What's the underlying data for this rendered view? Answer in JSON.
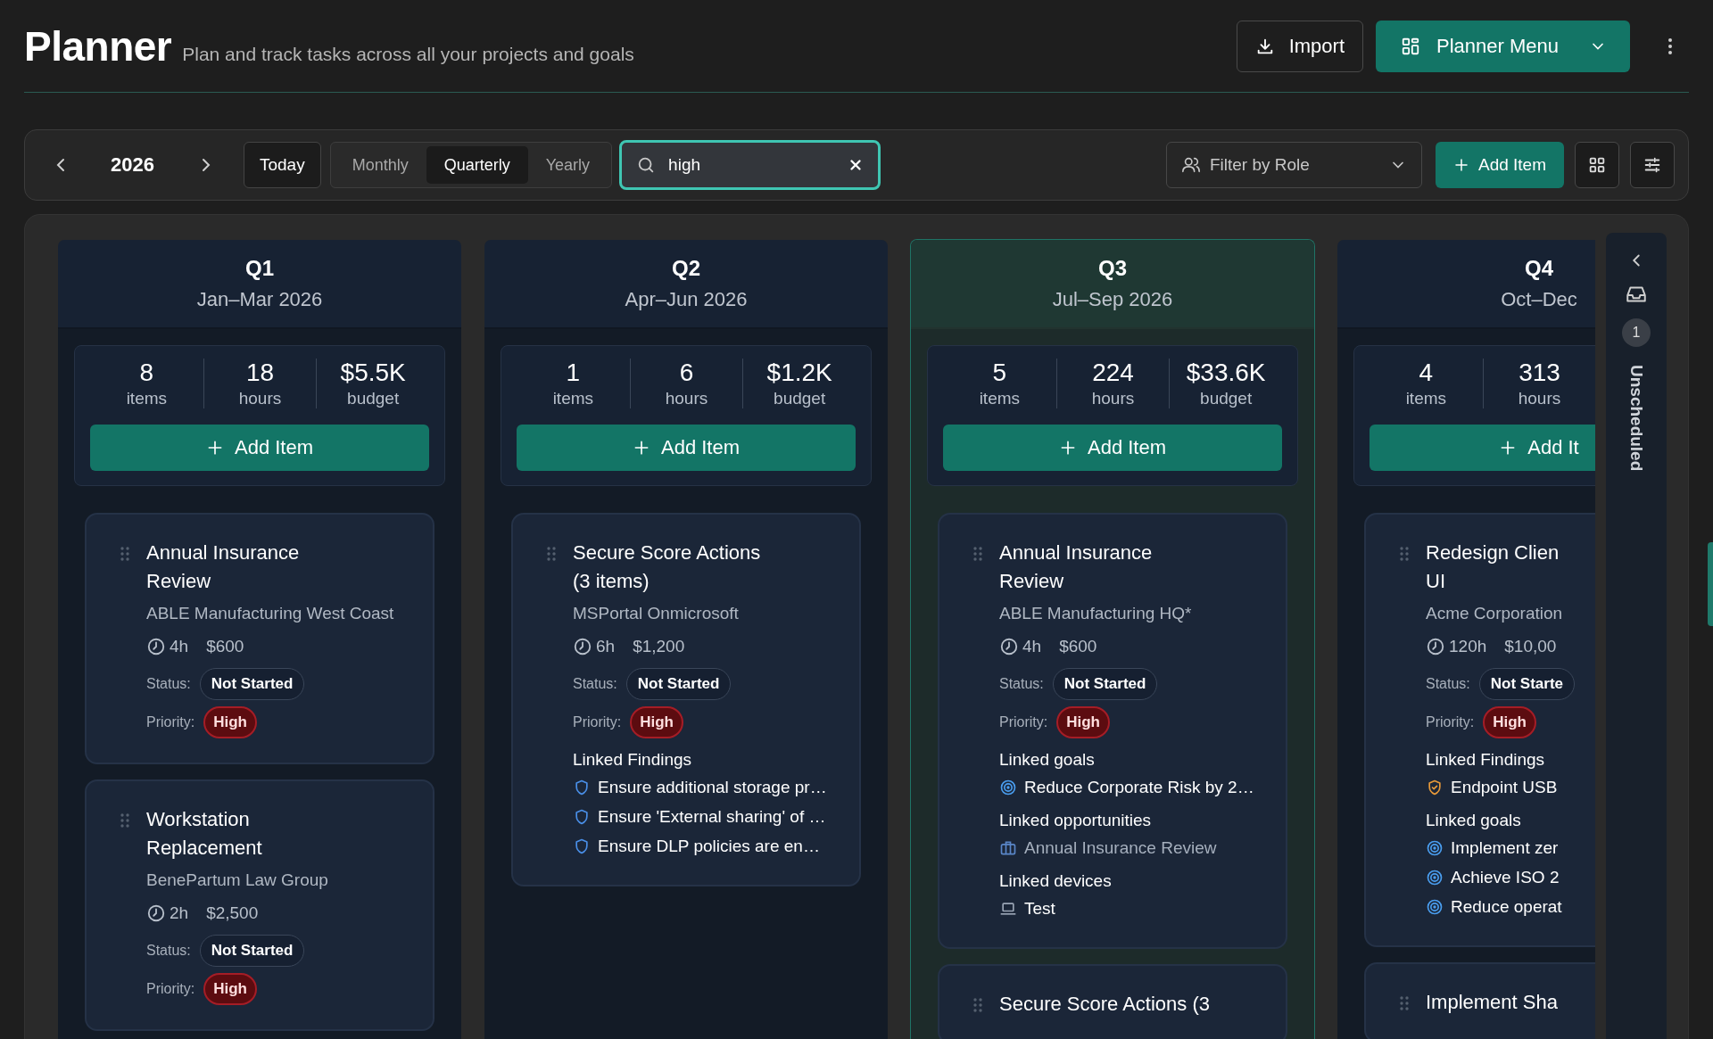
{
  "header": {
    "title": "Planner",
    "subtitle": "Plan and track tasks across all your projects and goals",
    "import_label": "Import",
    "menu_label": "Planner Menu"
  },
  "toolbar": {
    "year": "2026",
    "today_label": "Today",
    "views": [
      {
        "label": "Monthly",
        "selected": false
      },
      {
        "label": "Quarterly",
        "selected": true
      },
      {
        "label": "Yearly",
        "selected": false
      }
    ],
    "search": {
      "value": "high"
    },
    "role_filter": {
      "label": "Filter by Role"
    },
    "add_label": "Add Item"
  },
  "columns": [
    {
      "quarter": "Q1",
      "range": "Jan–Mar 2026",
      "current": false,
      "stats": [
        {
          "value": "8",
          "label": "items"
        },
        {
          "value": "18",
          "label": "hours"
        },
        {
          "value": "$5.5K",
          "label": "budget"
        }
      ],
      "add_label": "Add Item",
      "cards": [
        {
          "title": "Annual Insurance Review",
          "client": "ABLE Manufacturing West Coast",
          "hours": "4h",
          "cost": "$600",
          "status_label": "Status:",
          "status": "Not Started",
          "priority_label": "Priority:",
          "priority": "High"
        },
        {
          "title": "Workstation Replacement",
          "client": "BenePartum Law Group",
          "hours": "2h",
          "cost": "$2,500",
          "status_label": "Status:",
          "status": "Not Started",
          "priority_label": "Priority:",
          "priority": "High"
        }
      ]
    },
    {
      "quarter": "Q2",
      "range": "Apr–Jun 2026",
      "current": false,
      "stats": [
        {
          "value": "1",
          "label": "items"
        },
        {
          "value": "6",
          "label": "hours"
        },
        {
          "value": "$1.2K",
          "label": "budget"
        }
      ],
      "add_label": "Add Item",
      "cards": [
        {
          "title": "Secure Score Actions (3 items)",
          "client": "MSPortal Onmicrosoft",
          "hours": "6h",
          "cost": "$1,200",
          "status_label": "Status:",
          "status": "Not Started",
          "priority_label": "Priority:",
          "priority": "High",
          "sections": [
            {
              "heading": "Linked Findings",
              "items": [
                {
                  "kind": "shield",
                  "text": "Ensure additional storage pr…"
                },
                {
                  "kind": "shield",
                  "text": "Ensure 'External sharing' of …"
                },
                {
                  "kind": "shield",
                  "text": "Ensure DLP policies are en…"
                }
              ]
            }
          ]
        }
      ]
    },
    {
      "quarter": "Q3",
      "range": "Jul–Sep 2026",
      "current": true,
      "stats": [
        {
          "value": "5",
          "label": "items"
        },
        {
          "value": "224",
          "label": "hours"
        },
        {
          "value": "$33.6K",
          "label": "budget"
        }
      ],
      "add_label": "Add Item",
      "cards": [
        {
          "title": "Annual Insurance Review",
          "client": "ABLE Manufacturing HQ*",
          "hours": "4h",
          "cost": "$600",
          "status_label": "Status:",
          "status": "Not Started",
          "priority_label": "Priority:",
          "priority": "High",
          "sections": [
            {
              "heading": "Linked goals",
              "items": [
                {
                  "kind": "goal",
                  "text": "Reduce Corporate Risk by 2…"
                }
              ]
            },
            {
              "heading": "Linked opportunities",
              "items": [
                {
                  "kind": "opportunity",
                  "text": "Annual Insurance Review"
                }
              ]
            },
            {
              "heading": "Linked devices",
              "items": [
                {
                  "kind": "device",
                  "text": "Test"
                }
              ]
            }
          ]
        },
        {
          "title": "Secure Score Actions (3"
        }
      ]
    },
    {
      "quarter": "Q4",
      "range": "Oct–Dec",
      "current": false,
      "stats": [
        {
          "value": "4",
          "label": "items"
        },
        {
          "value": "313",
          "label": "hours"
        }
      ],
      "add_label": "Add It",
      "cards": [
        {
          "title": "Redesign Clien\nUI",
          "client": "Acme Corporation",
          "hours": "120h",
          "cost": "$10,00",
          "status_label": "Status:",
          "status": "Not Starte",
          "priority_label": "Priority:",
          "priority": "High",
          "sections": [
            {
              "heading": "Linked Findings",
              "items": [
                {
                  "kind": "shield-check",
                  "text": "Endpoint USB"
                }
              ]
            },
            {
              "heading": "Linked goals",
              "items": [
                {
                  "kind": "goal",
                  "text": "Implement zer"
                },
                {
                  "kind": "goal",
                  "text": "Achieve ISO 2"
                },
                {
                  "kind": "goal",
                  "text": "Reduce operat"
                }
              ]
            }
          ]
        },
        {
          "title": "Implement Sha"
        }
      ]
    }
  ],
  "unscheduled": {
    "count": "1",
    "label": "Unscheduled"
  }
}
